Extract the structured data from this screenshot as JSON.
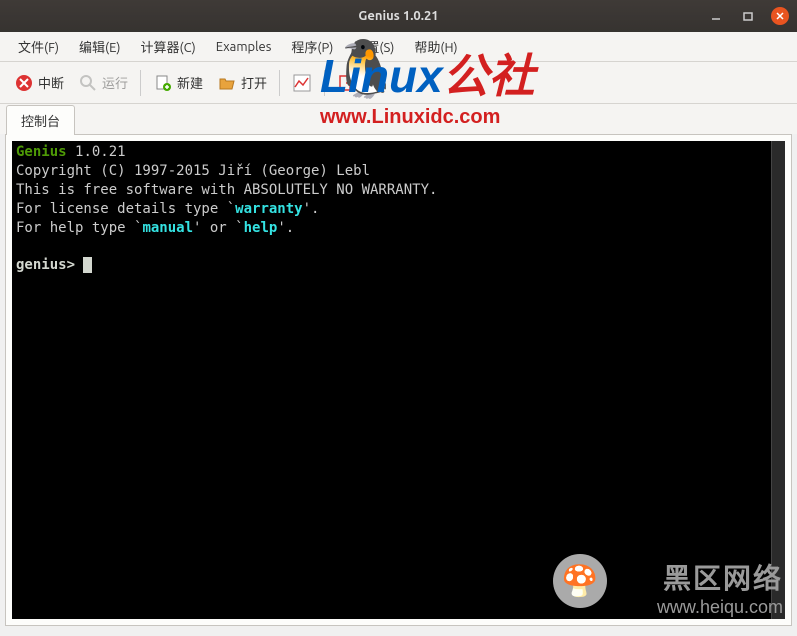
{
  "titlebar": {
    "title": "Genius 1.0.21"
  },
  "menubar": {
    "file": "文件(F)",
    "edit": "编辑(E)",
    "calculator": "计算器(C)",
    "examples": "Examples",
    "program": "程序(P)",
    "settings": "设置(S)",
    "help": "帮助(H)"
  },
  "toolbar": {
    "interrupt": "中断",
    "run": "运行",
    "new": "新建",
    "open": "打开",
    "exit": "退出"
  },
  "tabs": {
    "console": "控制台"
  },
  "terminal": {
    "app_name": "Genius",
    "version": "1.0.21",
    "copyright": "Copyright (C) 1997-2015 Jiří (George) Lebl",
    "warranty": "This is free software with ABSOLUTELY NO WARRANTY.",
    "license_hint_pre": "For license details type `",
    "license_keyword": "warranty",
    "license_hint_post": "'.",
    "help_hint_pre": "For help type `",
    "help_kw1": "manual",
    "help_mid": "' or `",
    "help_kw2": "help",
    "help_hint_post": "'.",
    "prompt": "genius> "
  },
  "watermarks": {
    "linux_text": "Linux",
    "linux_suffix": "公社",
    "linux_url": "www.Linuxidc.com",
    "heiqu_cn": "黑区网络",
    "heiqu_url": "www.heiqu.com"
  }
}
